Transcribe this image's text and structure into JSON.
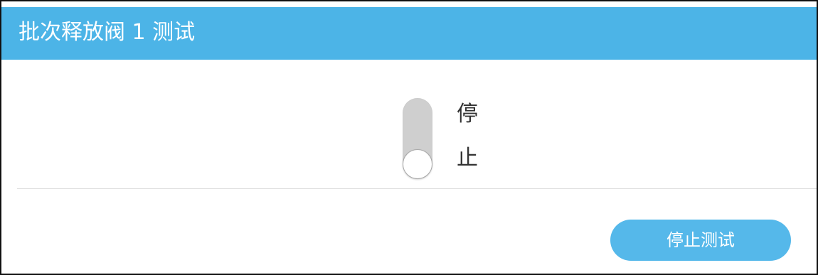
{
  "dialog": {
    "title": "批次释放阀 1 测试"
  },
  "toggle": {
    "label": "停止",
    "state": "off"
  },
  "actions": {
    "stop_test_label": "停止测试"
  },
  "colors": {
    "title_bar": "#4cb4e7",
    "button": "#55b8ea",
    "toggle_track": "#cfcfcf",
    "text": "#333333"
  }
}
